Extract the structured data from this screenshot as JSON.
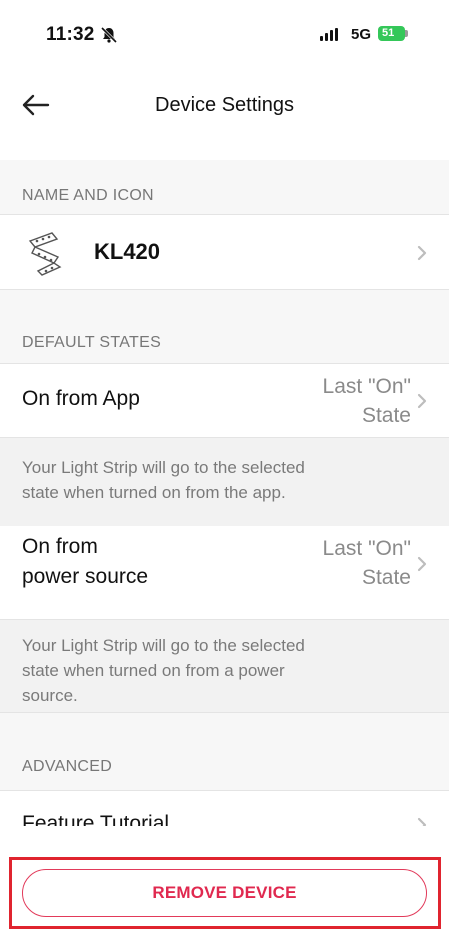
{
  "status_bar": {
    "time": "11:32",
    "network": "5G",
    "battery": "51"
  },
  "nav": {
    "title": "Device Settings"
  },
  "sections": {
    "name_and_icon": "NAME AND ICON",
    "default_states": "DEFAULT STATES",
    "advanced": "ADVANCED"
  },
  "device": {
    "name": "KL420"
  },
  "default_states": {
    "on_from_app": {
      "label": "On from App",
      "value_line1": "Last \"On\"",
      "value_line2": "State",
      "description_line1": "Your Light Strip will go to the selected",
      "description_line2": "state when turned on from the app."
    },
    "on_from_power": {
      "label_line1": "On from",
      "label_line2": "power source",
      "value_line1": "Last \"On\"",
      "value_line2": "State",
      "description_line1": "Your Light Strip will go to the selected",
      "description_line2": "state when turned on from a power",
      "description_line3": "source."
    }
  },
  "advanced": {
    "feature_tutorial": "Feature Tutorial"
  },
  "actions": {
    "remove_device": "REMOVE DEVICE"
  },
  "colors": {
    "accent_red": "#e0294f",
    "highlight_box": "#e0242f",
    "battery_green": "#34c759"
  }
}
